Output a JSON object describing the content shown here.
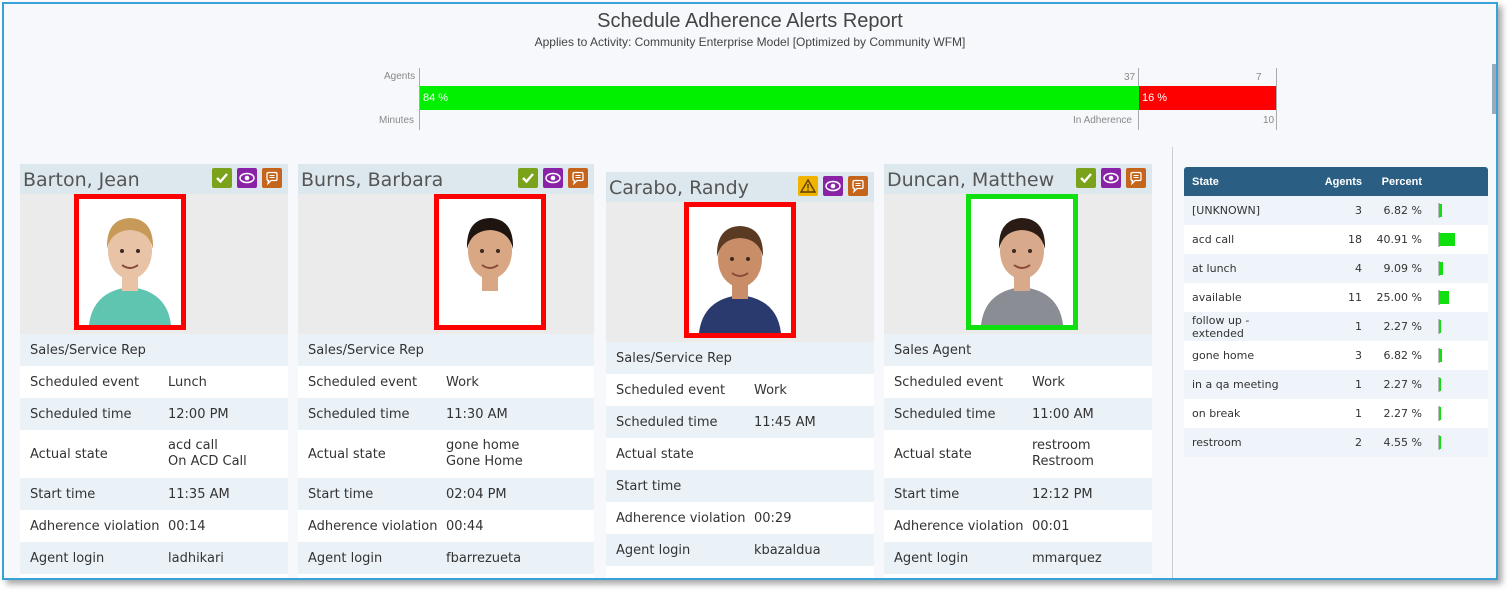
{
  "report": {
    "title": "Schedule Adherence Alerts Report",
    "subtitle": "Applies to Activity: Community Enterprise Model [Optimized by Community WFM]"
  },
  "summary_bar": {
    "agents_label": "Agents",
    "minutes_label": "Minutes",
    "in_adherence_label": "In Adherence",
    "green_agents": "37",
    "red_agents": "7",
    "red_minutes": "10",
    "green_percent_label": "84 %",
    "red_percent_label": "16 %",
    "green_fraction": 0.84,
    "green_color": "#00f000",
    "red_color": "#ff0000"
  },
  "agents": [
    {
      "name": "Barton, Jean",
      "status_icon": "check-icon",
      "in_adherence": false,
      "role": "Sales/Service Rep",
      "labels": [
        "Scheduled event",
        "Scheduled time",
        "Actual state",
        "Start time",
        "Adherence violation",
        "Agent login"
      ],
      "scheduled_event": "Lunch",
      "scheduled_time": "12:00 PM",
      "actual_state": "acd call",
      "actual_state_detail": "On ACD Call",
      "start_time": "11:35 AM",
      "adherence_violation": "00:14",
      "agent_login": "ladhikari"
    },
    {
      "name": "Burns, Barbara",
      "status_icon": "check-icon",
      "in_adherence": false,
      "role": "Sales/Service Rep",
      "labels": [
        "Scheduled event",
        "Scheduled time",
        "Actual state",
        "Start time",
        "Adherence violation",
        "Agent login"
      ],
      "scheduled_event": "Work",
      "scheduled_time": "11:30 AM",
      "actual_state": "gone home",
      "actual_state_detail": "Gone Home",
      "start_time": "02:04 PM",
      "adherence_violation": "00:44",
      "agent_login": "fbarrezueta"
    },
    {
      "name": "Carabo, Randy",
      "status_icon": "warning-icon",
      "in_adherence": false,
      "role": "Sales/Service Rep",
      "labels": [
        "Scheduled event",
        "Scheduled time",
        "Actual state",
        "Start time",
        "Adherence violation",
        "Agent login"
      ],
      "scheduled_event": "Work",
      "scheduled_time": "11:45 AM",
      "actual_state": "",
      "actual_state_detail": "",
      "start_time": "",
      "adherence_violation": "00:29",
      "agent_login": "kbazaldua"
    },
    {
      "name": "Duncan, Matthew",
      "status_icon": "check-icon",
      "in_adherence": true,
      "role": "Sales Agent",
      "labels": [
        "Scheduled event",
        "Scheduled time",
        "Actual state",
        "Start time",
        "Adherence violation",
        "Agent login"
      ],
      "scheduled_event": "Work",
      "scheduled_time": "11:00 AM",
      "actual_state": "restroom",
      "actual_state_detail": "Restroom",
      "start_time": "12:12 PM",
      "adherence_violation": "00:01",
      "agent_login": "mmarquez"
    }
  ],
  "state_table": {
    "headers": {
      "state": "State",
      "agents": "Agents",
      "percent": "Percent"
    },
    "rows": [
      {
        "state": "[UNKNOWN]",
        "agents": "3",
        "percent": "6.82 %",
        "fraction": 0.0682
      },
      {
        "state": "acd call",
        "agents": "18",
        "percent": "40.91 %",
        "fraction": 0.4091
      },
      {
        "state": "at lunch",
        "agents": "4",
        "percent": "9.09 %",
        "fraction": 0.0909
      },
      {
        "state": "available",
        "agents": "11",
        "percent": "25.00 %",
        "fraction": 0.25
      },
      {
        "state": "follow up - extended",
        "agents": "1",
        "percent": "2.27 %",
        "fraction": 0.0227
      },
      {
        "state": "gone home",
        "agents": "3",
        "percent": "6.82 %",
        "fraction": 0.0682
      },
      {
        "state": "in a qa meeting",
        "agents": "1",
        "percent": "2.27 %",
        "fraction": 0.0227
      },
      {
        "state": "on break",
        "agents": "1",
        "percent": "2.27 %",
        "fraction": 0.0227
      },
      {
        "state": "restroom",
        "agents": "2",
        "percent": "4.55 %",
        "fraction": 0.0455
      }
    ]
  }
}
